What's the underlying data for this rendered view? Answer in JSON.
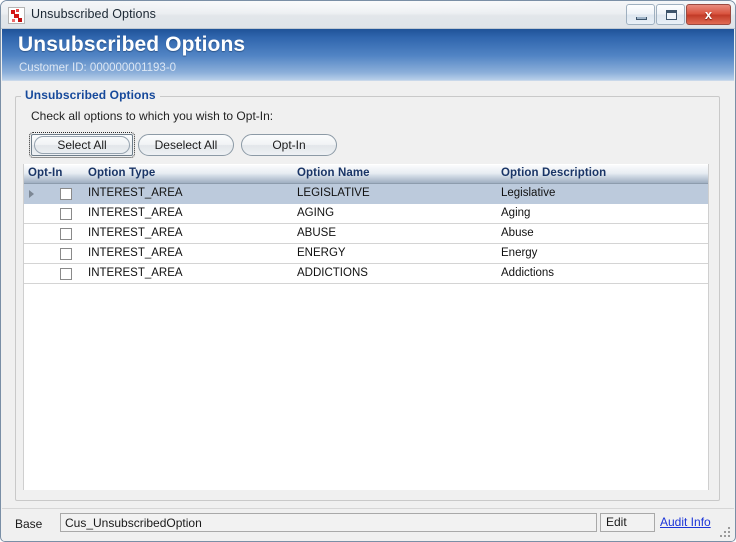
{
  "window": {
    "title": "Unsubscribed Options",
    "icon": "app-icon",
    "controls": {
      "minimize": "–",
      "maximize": "□",
      "close": "x"
    }
  },
  "banner": {
    "title": "Unsubscribed Options",
    "subtitle": "Customer ID: 000000001193-0",
    "gradient_top": "#1f5398",
    "gradient_bottom": "#b8cfe9"
  },
  "groupbox": {
    "legend": "Unsubscribed Options",
    "instructions": "Check all options to which you wish to Opt-In:",
    "legend_color": "#16499b"
  },
  "buttons": {
    "select_all": "Select All",
    "deselect_all": "Deselect All",
    "opt_in": "Opt-In",
    "focused": "select_all"
  },
  "grid": {
    "columns": [
      "Opt-In",
      "Option Type",
      "Option Name",
      "Option Description"
    ],
    "header_text_color": "#1a3566",
    "selected_row_color": "#bccadc",
    "rows": [
      {
        "checked": false,
        "option_type": "INTEREST_AREA",
        "option_name": "LEGISLATIVE",
        "option_description": "Legislative",
        "selected": true
      },
      {
        "checked": false,
        "option_type": "INTEREST_AREA",
        "option_name": "AGING",
        "option_description": "Aging",
        "selected": false
      },
      {
        "checked": false,
        "option_type": "INTEREST_AREA",
        "option_name": "ABUSE",
        "option_description": "Abuse",
        "selected": false
      },
      {
        "checked": false,
        "option_type": "INTEREST_AREA",
        "option_name": "ENERGY",
        "option_description": "Energy",
        "selected": false
      },
      {
        "checked": false,
        "option_type": "INTEREST_AREA",
        "option_name": "ADDICTIONS",
        "option_description": "Addictions",
        "selected": false
      }
    ]
  },
  "statusbar": {
    "label": "Base",
    "field_value": "Cus_UnsubscribedOption",
    "edit_label": "Edit",
    "audit_link": "Audit Info",
    "link_color": "#1b34d8"
  }
}
